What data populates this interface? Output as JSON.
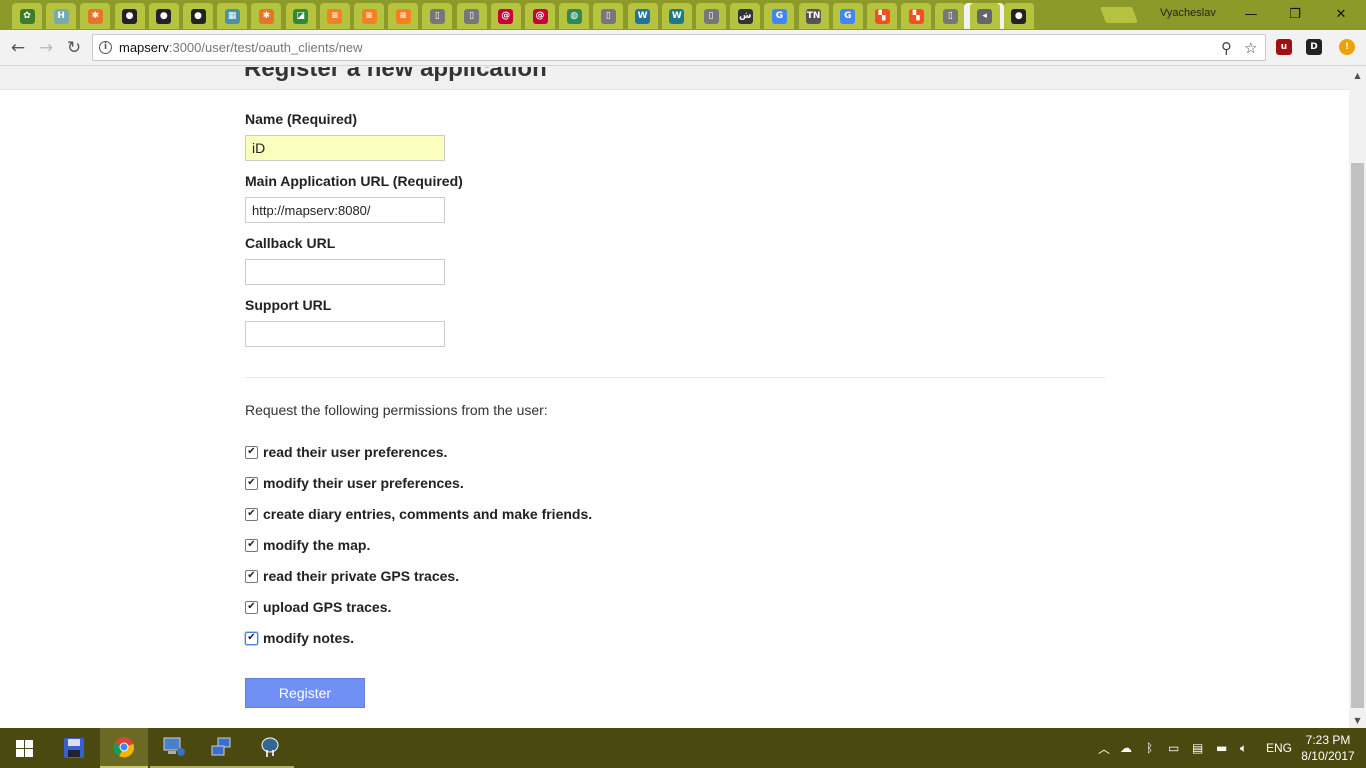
{
  "browser": {
    "tabs": [
      {
        "icon": "tree-icon",
        "color": "#3a7d2a",
        "glyph": "✿"
      },
      {
        "icon": "h-icon",
        "color": "#7aa",
        "glyph": "H"
      },
      {
        "icon": "asterisk-orange-icon",
        "color": "#e8742a",
        "glyph": "✱"
      },
      {
        "icon": "github-icon",
        "color": "#222",
        "glyph": "●"
      },
      {
        "icon": "github-icon",
        "color": "#222",
        "glyph": "●"
      },
      {
        "icon": "github-icon",
        "color": "#222",
        "glyph": "●"
      },
      {
        "icon": "grid-icon",
        "color": "#4a90a8",
        "glyph": "▦"
      },
      {
        "icon": "asterisk-orange-icon",
        "color": "#e8742a",
        "glyph": "✱"
      },
      {
        "icon": "green-square-icon",
        "color": "#2e8b3a",
        "glyph": "◪"
      },
      {
        "icon": "stack-icon",
        "color": "#f48024",
        "glyph": "≡"
      },
      {
        "icon": "stack-icon",
        "color": "#f48024",
        "glyph": "≡"
      },
      {
        "icon": "stack-icon",
        "color": "#f48024",
        "glyph": "≡"
      },
      {
        "icon": "page-icon",
        "color": "#777",
        "glyph": "▯"
      },
      {
        "icon": "page-icon",
        "color": "#777",
        "glyph": "▯"
      },
      {
        "icon": "debian-icon",
        "color": "#c70036",
        "glyph": "@"
      },
      {
        "icon": "debian-icon",
        "color": "#c70036",
        "glyph": "@"
      },
      {
        "icon": "green-circle-icon",
        "color": "#2e8b57",
        "glyph": "◍"
      },
      {
        "icon": "page-icon",
        "color": "#777",
        "glyph": "▯"
      },
      {
        "icon": "wordpress-icon",
        "color": "#21759b",
        "glyph": "W"
      },
      {
        "icon": "w-teal-icon",
        "color": "#1a7a8a",
        "glyph": "W"
      },
      {
        "icon": "page-icon",
        "color": "#777",
        "glyph": "▯"
      },
      {
        "icon": "arabic-icon",
        "color": "#333",
        "glyph": "ش"
      },
      {
        "icon": "google-icon",
        "color": "#4285f4",
        "glyph": "G"
      },
      {
        "icon": "tn-icon",
        "color": "#555",
        "glyph": "TN"
      },
      {
        "icon": "google-icon",
        "color": "#4285f4",
        "glyph": "G"
      },
      {
        "icon": "microsoft-icon",
        "color": "#f25022",
        "glyph": "▚"
      },
      {
        "icon": "microsoft-icon",
        "color": "#f25022",
        "glyph": "▚"
      },
      {
        "icon": "page-icon",
        "color": "#777",
        "glyph": "▯"
      },
      {
        "icon": "speaker-icon",
        "color": "#666",
        "glyph": "◂"
      },
      {
        "icon": "github-icon",
        "color": "#222",
        "glyph": "●"
      }
    ],
    "active_tab_close": "×",
    "profile_name": "Vyacheslav",
    "url_host": "mapserv",
    "url_path": ":3000/user/test/oauth_clients/new"
  },
  "form": {
    "page_title_clipped": "Register a new application",
    "name_label": "Name (Required)",
    "name_value": "iD",
    "main_url_label": "Main Application URL (Required)",
    "main_url_value": "http://mapserv:8080/",
    "callback_label": "Callback URL",
    "callback_value": "",
    "support_label": "Support URL",
    "support_value": "",
    "permissions_intro": "Request the following permissions from the user:",
    "permissions": [
      {
        "label": "read their user preferences.",
        "checked": true
      },
      {
        "label": "modify their user preferences.",
        "checked": true
      },
      {
        "label": "create diary entries, comments and make friends.",
        "checked": true
      },
      {
        "label": "modify the map.",
        "checked": true
      },
      {
        "label": "read their private GPS traces.",
        "checked": true
      },
      {
        "label": "upload GPS traces.",
        "checked": true
      },
      {
        "label": "modify notes.",
        "checked": true
      }
    ],
    "submit_label": "Register"
  },
  "taskbar": {
    "apps": [
      "save-disk-icon",
      "chrome-icon",
      "network-computer-icon",
      "remote-desktop-icon",
      "postgres-elephant-icon"
    ],
    "language": "ENG",
    "time": "7:23 PM",
    "date": "8/10/2017"
  }
}
